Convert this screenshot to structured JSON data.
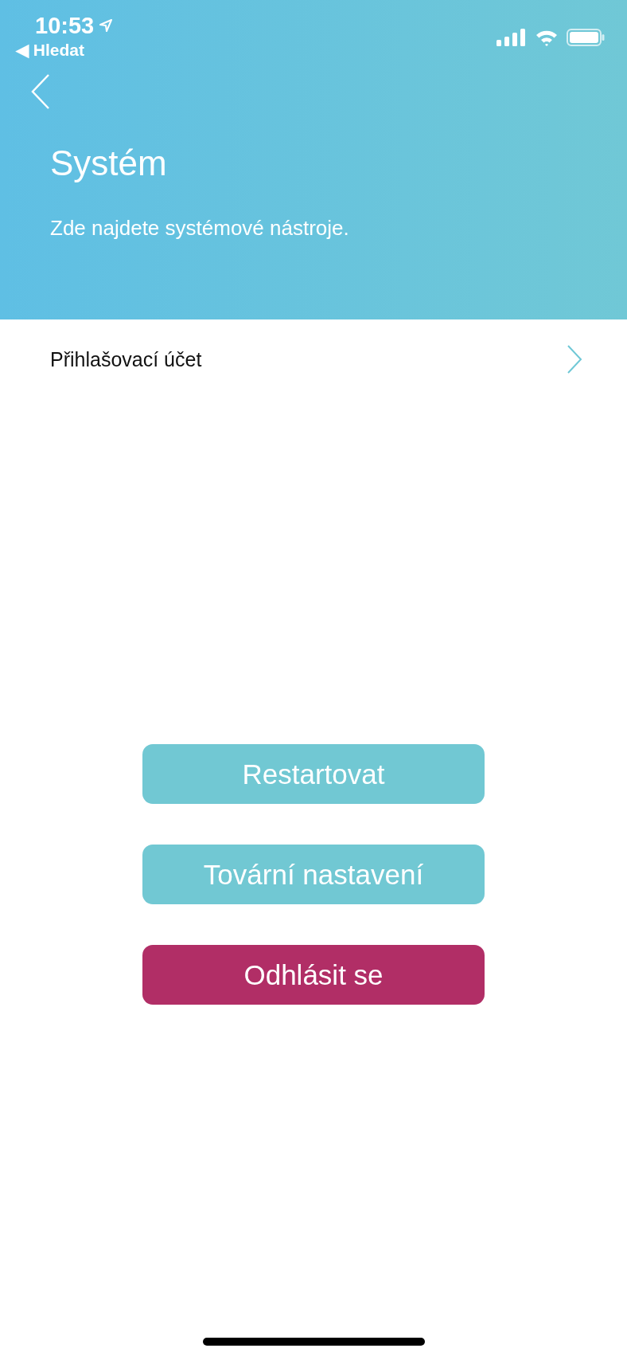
{
  "status_bar": {
    "time": "10:53",
    "back_link": "◀ Hledat"
  },
  "header": {
    "title": "Systém",
    "subtitle": "Zde najdete systémové nástroje."
  },
  "menu_items": [
    {
      "label": "Přihlašovací účet"
    }
  ],
  "buttons": [
    {
      "label": "Restartovat",
      "kind": "primary"
    },
    {
      "label": "Tovární nastavení",
      "kind": "primary"
    },
    {
      "label": "Odhlásit se",
      "kind": "danger"
    }
  ]
}
